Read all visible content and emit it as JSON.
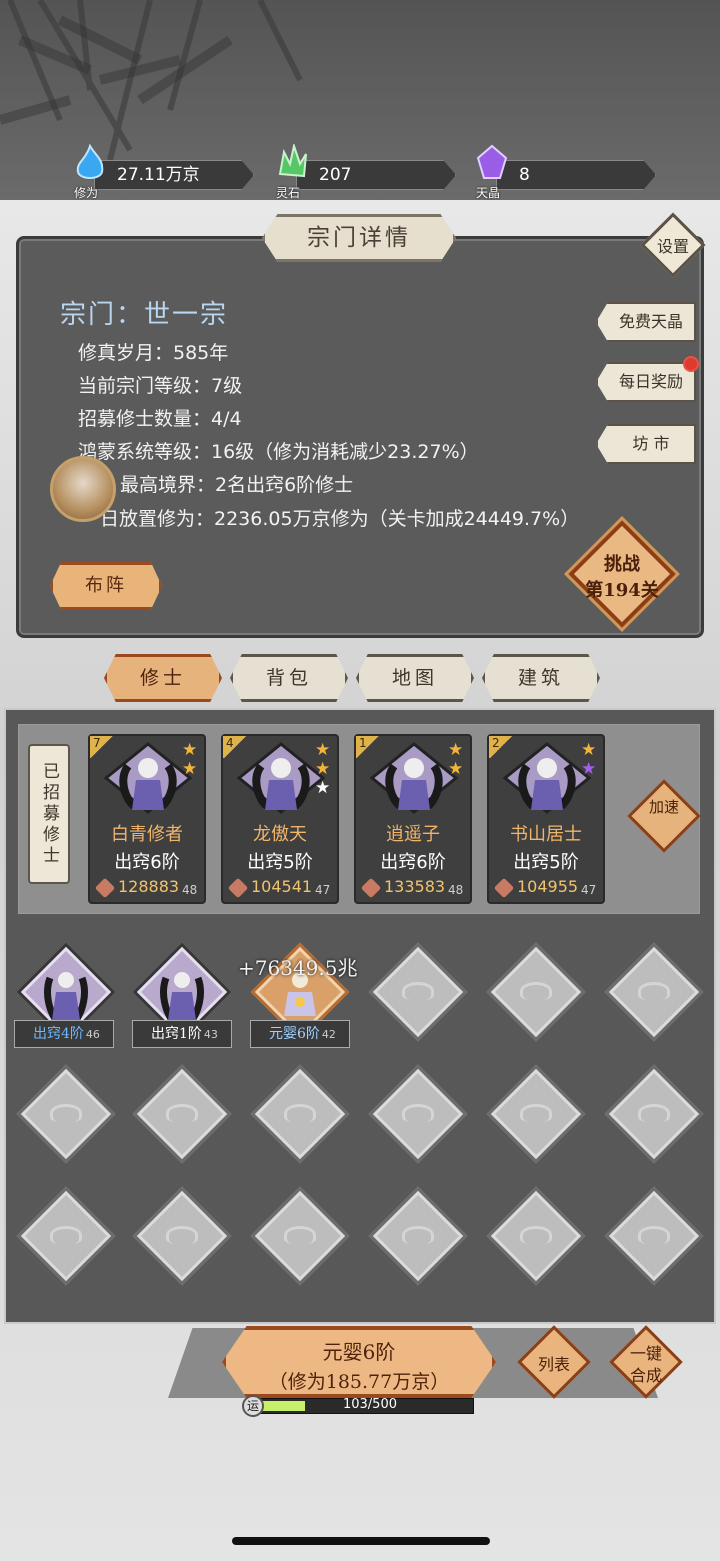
{
  "resources": [
    {
      "name": "修为",
      "value": "27.11万京",
      "icon": "blue-flame-icon",
      "color": "#4ab3f0"
    },
    {
      "name": "灵石",
      "value": "207",
      "icon": "green-crystal-icon",
      "color": "#5ccf6a"
    },
    {
      "name": "天晶",
      "value": "8",
      "icon": "purple-gem-icon",
      "color": "#a56ce8"
    }
  ],
  "panel": {
    "title": "宗门详情",
    "settings": "设置",
    "sect_name": "宗门：世一宗",
    "stats": [
      "修真岁月：585年",
      "当前宗门等级：7级",
      "招募修士数量：4/4",
      "鸿蒙系统等级：16级（修为消耗减少23.27%）",
      "最高境界：2名出窍6阶修士",
      "日放置修为：2236.05万京修为（关卡加成24449.7%）"
    ],
    "side_buttons": [
      "免费天晶",
      "每日奖励",
      "坊 市"
    ],
    "formation_button": "布阵",
    "challenge": {
      "line1": "挑战",
      "line2": "第194关"
    }
  },
  "tabs": [
    "修士",
    "背包",
    "地图",
    "建筑"
  ],
  "recruited": {
    "label": "已招募修士",
    "accelerate": "加速",
    "cards": [
      {
        "level": "7",
        "name": "白青修者",
        "rank": "出窍6阶",
        "power": "128883",
        "sub": "48",
        "stars": [
          "#f2b53a",
          "#f2b53a"
        ]
      },
      {
        "level": "4",
        "name": "龙傲天",
        "rank": "出窍5阶",
        "power": "104541",
        "sub": "47",
        "stars": [
          "#f2b53a",
          "#f2b53a",
          "#ffffff"
        ]
      },
      {
        "level": "1",
        "name": "逍遥子",
        "rank": "出窍6阶",
        "power": "133583",
        "sub": "48",
        "stars": [
          "#f2b53a",
          "#f2b53a"
        ]
      },
      {
        "level": "2",
        "name": "书山居士",
        "rank": "出窍5阶",
        "power": "104955",
        "sub": "47",
        "stars": [
          "#f2b53a",
          "#a55ff0"
        ]
      }
    ]
  },
  "floating_gain": "+76349.5兆",
  "slots": [
    {
      "label": "出窍4阶",
      "num": "46",
      "label_color": "#6fb8ff",
      "type": "filled"
    },
    {
      "label": "出窍1阶",
      "num": "43",
      "label_color": "#ffffff",
      "type": "filled"
    },
    {
      "label": "元婴6阶",
      "num": "42",
      "label_color": "#9fd0ff",
      "type": "gold"
    }
  ],
  "bottom": {
    "merge_line1": "元婴6阶",
    "merge_line2": "（修为185.77万京）",
    "list_button": "列表",
    "oneclick_line1": "一键",
    "oneclick_line2": "合成",
    "luck_icon": "运",
    "luck_text": "103/500",
    "luck_value": 103,
    "luck_max": 500
  }
}
